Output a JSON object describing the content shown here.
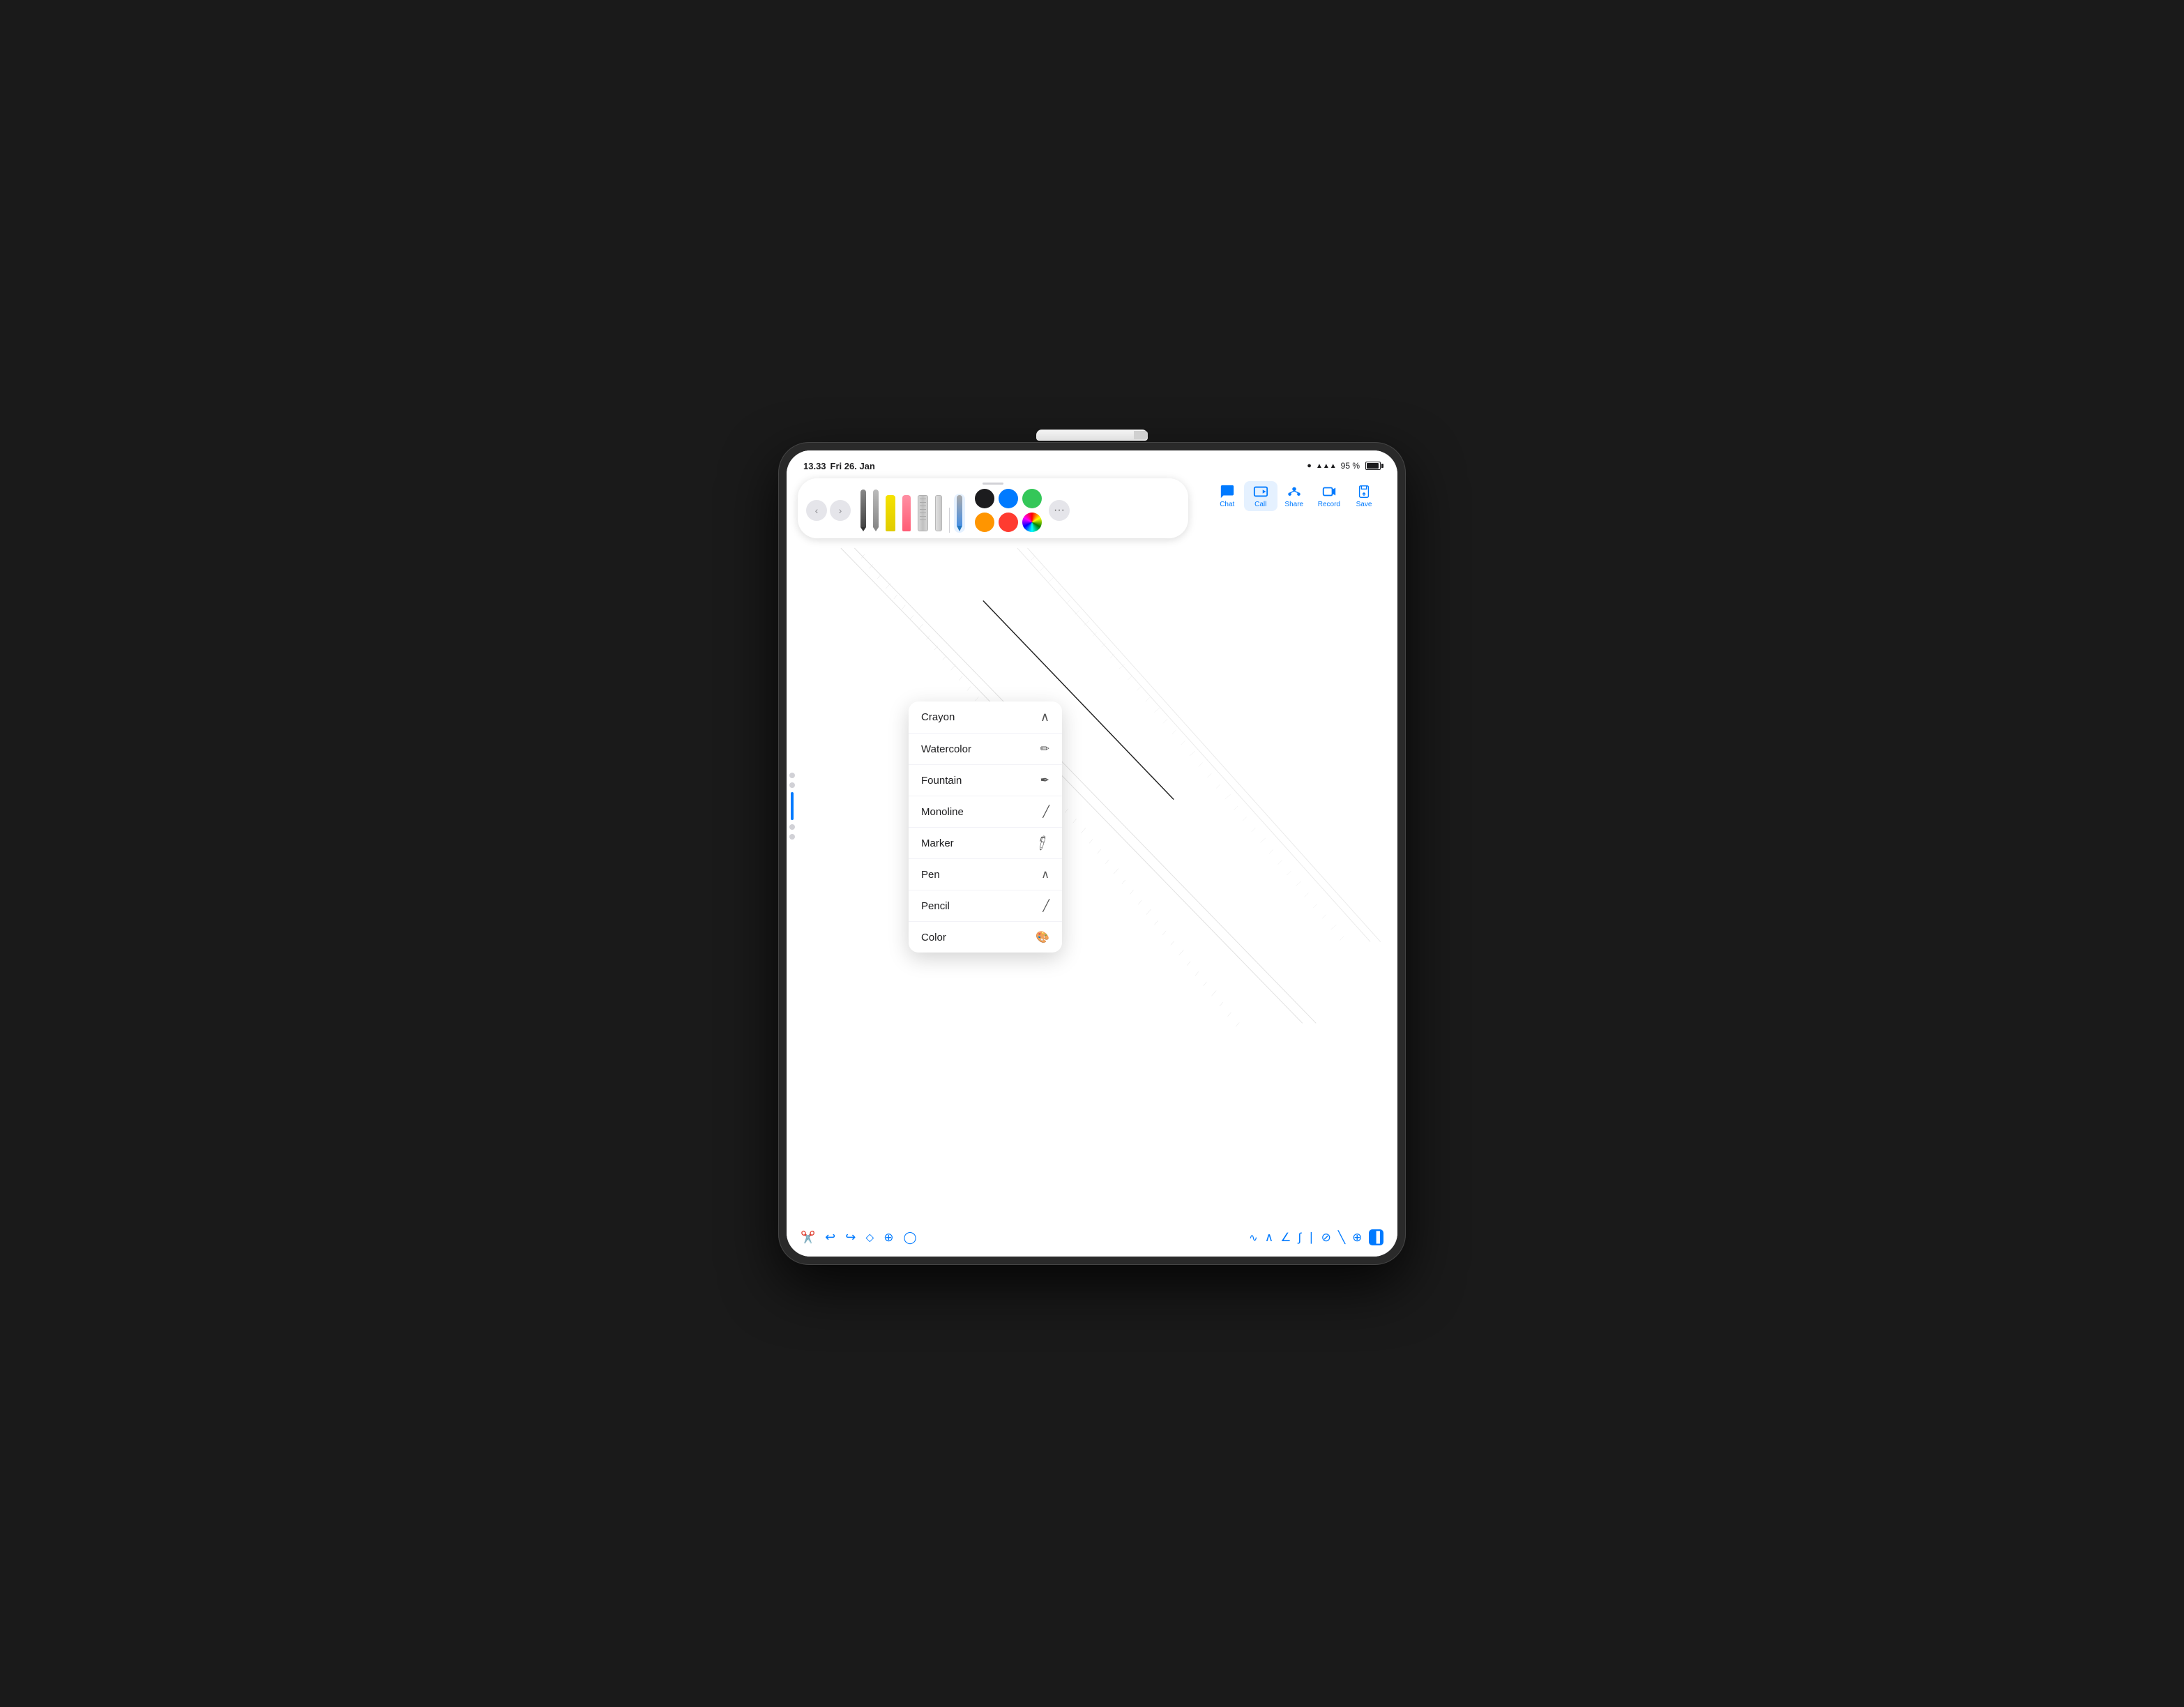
{
  "device": {
    "pencil_present": true
  },
  "status_bar": {
    "time": "13.33",
    "date": "Fri 26. Jan",
    "battery_percent": "95 %",
    "wifi": true,
    "dot_color": "#34c759"
  },
  "tools_pill": {
    "drag_handle": true,
    "tools": [
      {
        "id": "pen-black",
        "label": "Pen",
        "active": false
      },
      {
        "id": "pen-gray",
        "label": "Pen Gray",
        "active": false
      },
      {
        "id": "marker-yellow",
        "label": "Marker Yellow",
        "active": false
      },
      {
        "id": "marker-pink",
        "label": "Marker Pink",
        "active": false
      },
      {
        "id": "ruler-wide",
        "label": "Ruler Wide",
        "active": false
      },
      {
        "id": "ruler-slim",
        "label": "Ruler Slim",
        "active": false
      },
      {
        "id": "pen-blue",
        "label": "Pen Blue",
        "active": true
      }
    ],
    "colors": [
      {
        "id": "black",
        "hex": "#1c1c1e"
      },
      {
        "id": "blue",
        "hex": "#007aff"
      },
      {
        "id": "green",
        "hex": "#34c759"
      },
      {
        "id": "yellow-orange",
        "hex": "#ff9500"
      },
      {
        "id": "red",
        "hex": "#ff3b30"
      },
      {
        "id": "custom",
        "hex": "rainbow"
      }
    ],
    "more_button": "···"
  },
  "action_buttons": [
    {
      "id": "chat",
      "label": "Chat",
      "icon": "💬",
      "active": false
    },
    {
      "id": "call",
      "label": "Call",
      "icon": "📹",
      "active": true
    },
    {
      "id": "share",
      "label": "Share",
      "icon": "👥",
      "active": false
    },
    {
      "id": "record",
      "label": "Record",
      "icon": "⬜",
      "active": false
    },
    {
      "id": "save",
      "label": "Save",
      "icon": "⬆️",
      "active": false
    }
  ],
  "dropdown_menu": {
    "items": [
      {
        "id": "crayon",
        "label": "Crayon",
        "icon": "✏"
      },
      {
        "id": "watercolor",
        "label": "Watercolor",
        "icon": "🖌"
      },
      {
        "id": "fountain",
        "label": "Fountain",
        "icon": "✒"
      },
      {
        "id": "monoline",
        "label": "Monoline",
        "icon": "╱"
      },
      {
        "id": "marker",
        "label": "Marker",
        "icon": "🖊"
      },
      {
        "id": "pen",
        "label": "Pen",
        "icon": "✒"
      },
      {
        "id": "pencil",
        "label": "Pencil",
        "icon": "/"
      },
      {
        "id": "color",
        "label": "Color",
        "icon": "🎨"
      }
    ]
  },
  "bottom_toolbar": {
    "left_tools": [
      {
        "id": "scissors",
        "icon": "✂",
        "label": "scissors"
      },
      {
        "id": "undo",
        "icon": "↩",
        "label": "undo"
      },
      {
        "id": "redo",
        "icon": "↪",
        "label": "redo"
      },
      {
        "id": "eraser",
        "icon": "◇",
        "label": "eraser"
      },
      {
        "id": "lasso",
        "icon": "⭕",
        "label": "lasso"
      },
      {
        "id": "shape",
        "icon": "◯",
        "label": "shape"
      }
    ],
    "right_tools": [
      {
        "id": "brush-stroke",
        "icon": "∿",
        "label": "brush-stroke"
      },
      {
        "id": "calligraphy",
        "icon": "∧",
        "label": "calligraphy"
      },
      {
        "id": "angle",
        "icon": "∠",
        "label": "angle"
      },
      {
        "id": "fountain-pen",
        "icon": "∫",
        "label": "fountain-pen"
      },
      {
        "id": "pen-tool",
        "icon": "⌐",
        "label": "pen-tool"
      },
      {
        "id": "highlighter",
        "icon": "⊘",
        "label": "highlighter"
      },
      {
        "id": "pencil-tool",
        "icon": "∣",
        "label": "pencil-tool"
      },
      {
        "id": "palette",
        "icon": "⊕",
        "label": "palette"
      },
      {
        "id": "ruler-active",
        "icon": "▐",
        "label": "ruler-active",
        "active": true
      }
    ]
  }
}
